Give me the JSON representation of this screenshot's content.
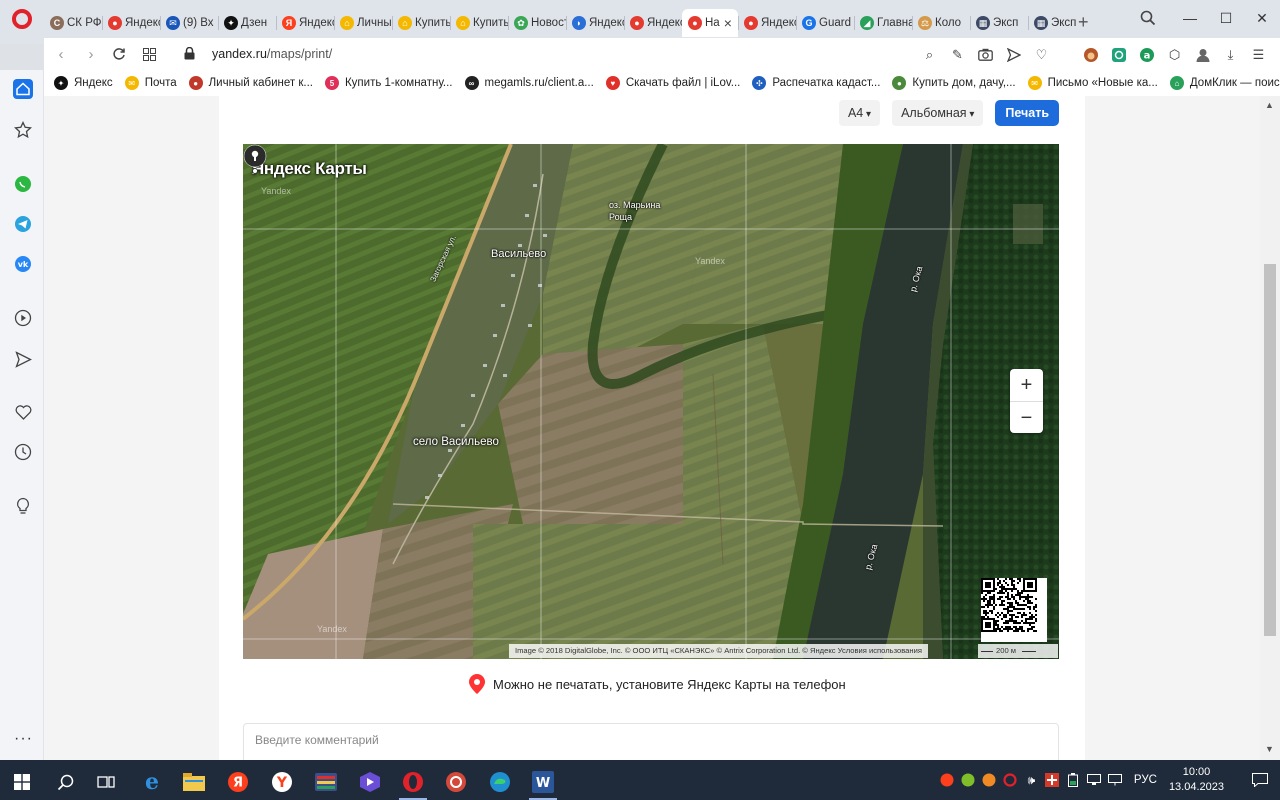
{
  "browser": {
    "tabs": [
      {
        "label": "СК РФ",
        "color": "#8a6d5a",
        "glyph": "С"
      },
      {
        "label": "Яндекс",
        "color": "#e43a2f",
        "glyph": "●"
      },
      {
        "label": "(9) Вх",
        "color": "#1a55b8",
        "glyph": "✉"
      },
      {
        "label": "Дзен",
        "color": "#111111",
        "glyph": "✦"
      },
      {
        "label": "Яндекс",
        "color": "#fc3f1d",
        "glyph": "Я"
      },
      {
        "label": "Личный",
        "color": "#f5b800",
        "glyph": "⌂"
      },
      {
        "label": "Купить",
        "color": "#f5b800",
        "glyph": "⌂"
      },
      {
        "label": "Купить",
        "color": "#f5b800",
        "glyph": "⌂"
      },
      {
        "label": "Новости",
        "color": "#3aa757",
        "glyph": "✿"
      },
      {
        "label": "Яндекс",
        "color": "#2a6fd6",
        "glyph": "◗"
      },
      {
        "label": "Яндекс",
        "color": "#e43a2f",
        "glyph": "●"
      },
      {
        "label": "На",
        "color": "#e43a2f",
        "glyph": "●",
        "active": true,
        "close": "×"
      },
      {
        "label": "Яндекс",
        "color": "#e43a2f",
        "glyph": "●"
      },
      {
        "label": "Guard",
        "color": "#1a73e8",
        "glyph": "G"
      },
      {
        "label": "Главная",
        "color": "#2aa15a",
        "glyph": "◢"
      },
      {
        "label": "Коло",
        "color": "#d49a4a",
        "glyph": "⚖"
      },
      {
        "label": "Эксп",
        "color": "#3d4a66",
        "glyph": "▦"
      },
      {
        "label": "Эксп",
        "color": "#3d4a66",
        "glyph": "▦"
      }
    ],
    "new_tab": "+",
    "window_controls": {
      "minimize": "—",
      "maximize": "☐",
      "close": "✕"
    },
    "url": {
      "host": "yandex.ru",
      "path": "/maps/print/"
    },
    "bookmarks": [
      {
        "label": "Яндекс",
        "color": "#111111",
        "glyph": "✦"
      },
      {
        "label": "Почта",
        "color": "#f5b800",
        "glyph": "✉"
      },
      {
        "label": "Личный кабинет к...",
        "color": "#c0392b",
        "glyph": "●"
      },
      {
        "label": "Купить 1-комнатну...",
        "color": "#e0305a",
        "glyph": "5"
      },
      {
        "label": "megamls.ru/client.a...",
        "color": "#222222",
        "glyph": "∞"
      },
      {
        "label": "Скачать файл | iLov...",
        "color": "#e0302a",
        "glyph": "♥"
      },
      {
        "label": "Распечатка кадаст...",
        "color": "#1f5fbf",
        "glyph": "✣"
      },
      {
        "label": "Купить дом, дачу,...",
        "color": "#4a8a3a",
        "glyph": "●"
      },
      {
        "label": "Письмо «Новые ка...",
        "color": "#f5b800",
        "glyph": "✉"
      },
      {
        "label": "ДомКлик — поиск...",
        "color": "#2aa15a",
        "glyph": "⌂"
      }
    ]
  },
  "print": {
    "paper_size": "A4",
    "orientation": "Альбомная",
    "print_button": "Печать"
  },
  "map": {
    "logo": "Яндекс Карты",
    "labels": {
      "village": "Васильево",
      "grove": "оз. Марьина Роща",
      "river_top": "р. Ока",
      "river_bottom": "р. Ока",
      "road": "Загорская ул."
    },
    "watermarks": [
      "Yandex",
      "Yandex",
      "Yandex"
    ],
    "pin_label": "село Васильево",
    "zoom_in": "+",
    "zoom_out": "−",
    "attribution": "Image © 2018 DigitalGlobe, Inc. © ООО ИТЦ «СКАНЭКС» © Antrix Corporation Ltd. © Яндекс   Условия использования",
    "scale": "200 м"
  },
  "tip": "Можно не печатать, установите Яндекс Карты на телефон",
  "comment": {
    "placeholder": "Введите комментарий"
  },
  "taskbar": {
    "lang": "РУС",
    "time": "10:00",
    "date": "13.04.2023"
  }
}
